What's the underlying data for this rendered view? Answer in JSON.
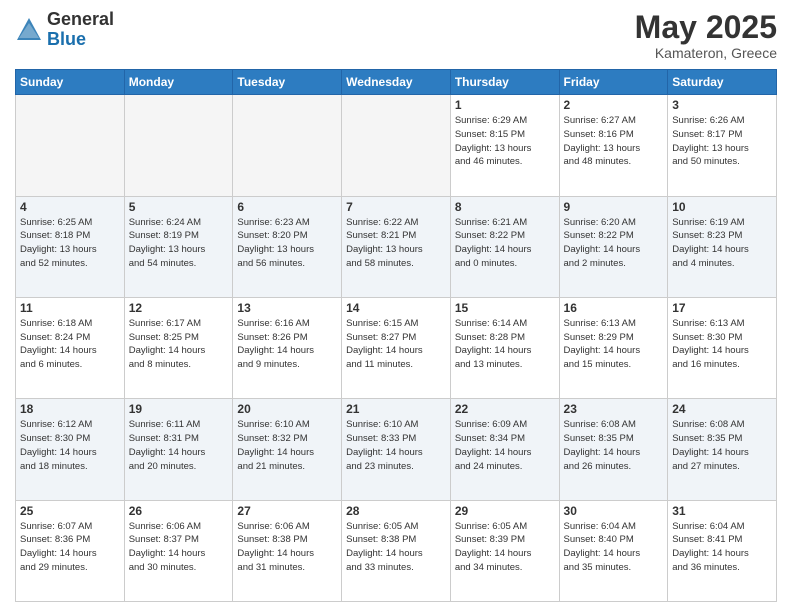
{
  "logo": {
    "general": "General",
    "blue": "Blue"
  },
  "header": {
    "month": "May 2025",
    "location": "Kamateron, Greece"
  },
  "days_of_week": [
    "Sunday",
    "Monday",
    "Tuesday",
    "Wednesday",
    "Thursday",
    "Friday",
    "Saturday"
  ],
  "weeks": [
    [
      {
        "day": "",
        "info": ""
      },
      {
        "day": "",
        "info": ""
      },
      {
        "day": "",
        "info": ""
      },
      {
        "day": "",
        "info": ""
      },
      {
        "day": "1",
        "info": "Sunrise: 6:29 AM\nSunset: 8:15 PM\nDaylight: 13 hours\nand 46 minutes."
      },
      {
        "day": "2",
        "info": "Sunrise: 6:27 AM\nSunset: 8:16 PM\nDaylight: 13 hours\nand 48 minutes."
      },
      {
        "day": "3",
        "info": "Sunrise: 6:26 AM\nSunset: 8:17 PM\nDaylight: 13 hours\nand 50 minutes."
      }
    ],
    [
      {
        "day": "4",
        "info": "Sunrise: 6:25 AM\nSunset: 8:18 PM\nDaylight: 13 hours\nand 52 minutes."
      },
      {
        "day": "5",
        "info": "Sunrise: 6:24 AM\nSunset: 8:19 PM\nDaylight: 13 hours\nand 54 minutes."
      },
      {
        "day": "6",
        "info": "Sunrise: 6:23 AM\nSunset: 8:20 PM\nDaylight: 13 hours\nand 56 minutes."
      },
      {
        "day": "7",
        "info": "Sunrise: 6:22 AM\nSunset: 8:21 PM\nDaylight: 13 hours\nand 58 minutes."
      },
      {
        "day": "8",
        "info": "Sunrise: 6:21 AM\nSunset: 8:22 PM\nDaylight: 14 hours\nand 0 minutes."
      },
      {
        "day": "9",
        "info": "Sunrise: 6:20 AM\nSunset: 8:22 PM\nDaylight: 14 hours\nand 2 minutes."
      },
      {
        "day": "10",
        "info": "Sunrise: 6:19 AM\nSunset: 8:23 PM\nDaylight: 14 hours\nand 4 minutes."
      }
    ],
    [
      {
        "day": "11",
        "info": "Sunrise: 6:18 AM\nSunset: 8:24 PM\nDaylight: 14 hours\nand 6 minutes."
      },
      {
        "day": "12",
        "info": "Sunrise: 6:17 AM\nSunset: 8:25 PM\nDaylight: 14 hours\nand 8 minutes."
      },
      {
        "day": "13",
        "info": "Sunrise: 6:16 AM\nSunset: 8:26 PM\nDaylight: 14 hours\nand 9 minutes."
      },
      {
        "day": "14",
        "info": "Sunrise: 6:15 AM\nSunset: 8:27 PM\nDaylight: 14 hours\nand 11 minutes."
      },
      {
        "day": "15",
        "info": "Sunrise: 6:14 AM\nSunset: 8:28 PM\nDaylight: 14 hours\nand 13 minutes."
      },
      {
        "day": "16",
        "info": "Sunrise: 6:13 AM\nSunset: 8:29 PM\nDaylight: 14 hours\nand 15 minutes."
      },
      {
        "day": "17",
        "info": "Sunrise: 6:13 AM\nSunset: 8:30 PM\nDaylight: 14 hours\nand 16 minutes."
      }
    ],
    [
      {
        "day": "18",
        "info": "Sunrise: 6:12 AM\nSunset: 8:30 PM\nDaylight: 14 hours\nand 18 minutes."
      },
      {
        "day": "19",
        "info": "Sunrise: 6:11 AM\nSunset: 8:31 PM\nDaylight: 14 hours\nand 20 minutes."
      },
      {
        "day": "20",
        "info": "Sunrise: 6:10 AM\nSunset: 8:32 PM\nDaylight: 14 hours\nand 21 minutes."
      },
      {
        "day": "21",
        "info": "Sunrise: 6:10 AM\nSunset: 8:33 PM\nDaylight: 14 hours\nand 23 minutes."
      },
      {
        "day": "22",
        "info": "Sunrise: 6:09 AM\nSunset: 8:34 PM\nDaylight: 14 hours\nand 24 minutes."
      },
      {
        "day": "23",
        "info": "Sunrise: 6:08 AM\nSunset: 8:35 PM\nDaylight: 14 hours\nand 26 minutes."
      },
      {
        "day": "24",
        "info": "Sunrise: 6:08 AM\nSunset: 8:35 PM\nDaylight: 14 hours\nand 27 minutes."
      }
    ],
    [
      {
        "day": "25",
        "info": "Sunrise: 6:07 AM\nSunset: 8:36 PM\nDaylight: 14 hours\nand 29 minutes."
      },
      {
        "day": "26",
        "info": "Sunrise: 6:06 AM\nSunset: 8:37 PM\nDaylight: 14 hours\nand 30 minutes."
      },
      {
        "day": "27",
        "info": "Sunrise: 6:06 AM\nSunset: 8:38 PM\nDaylight: 14 hours\nand 31 minutes."
      },
      {
        "day": "28",
        "info": "Sunrise: 6:05 AM\nSunset: 8:38 PM\nDaylight: 14 hours\nand 33 minutes."
      },
      {
        "day": "29",
        "info": "Sunrise: 6:05 AM\nSunset: 8:39 PM\nDaylight: 14 hours\nand 34 minutes."
      },
      {
        "day": "30",
        "info": "Sunrise: 6:04 AM\nSunset: 8:40 PM\nDaylight: 14 hours\nand 35 minutes."
      },
      {
        "day": "31",
        "info": "Sunrise: 6:04 AM\nSunset: 8:41 PM\nDaylight: 14 hours\nand 36 minutes."
      }
    ]
  ]
}
